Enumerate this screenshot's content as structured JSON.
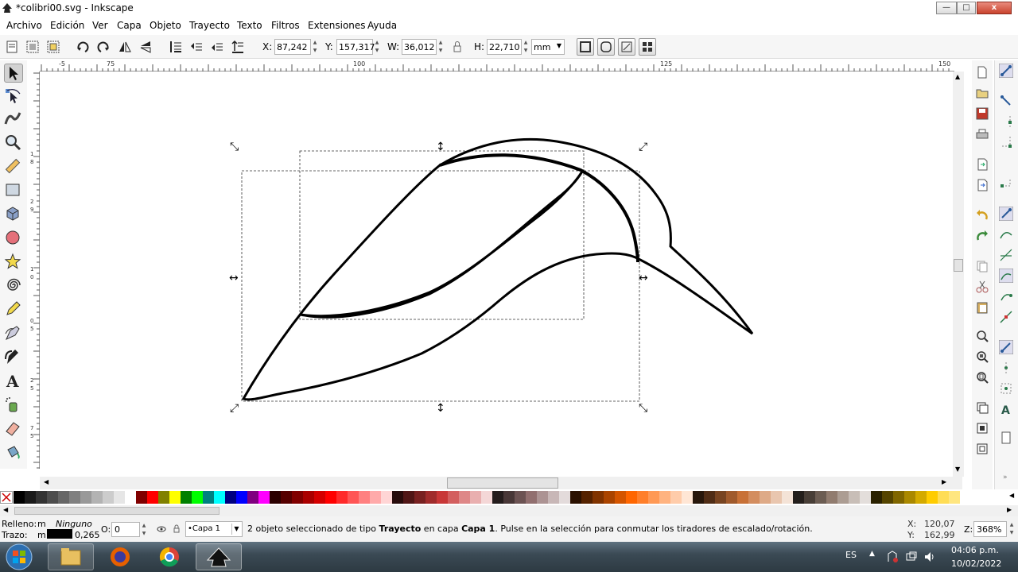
{
  "window": {
    "title": "*colibri00.svg - Inkscape",
    "min_label": "—",
    "max_label": "□",
    "close_label": "x"
  },
  "menu": [
    {
      "label": "Archivo"
    },
    {
      "label": "Edición"
    },
    {
      "label": "Ver"
    },
    {
      "label": "Capa"
    },
    {
      "label": "Objeto"
    },
    {
      "label": "Trayecto"
    },
    {
      "label": "Texto"
    },
    {
      "label": "Filtros"
    },
    {
      "label": "Extensiones"
    },
    {
      "label": "Ayuda"
    }
  ],
  "toolbar": {
    "x_label": "X:",
    "x_value": "87,242",
    "y_label": "Y:",
    "y_value": "157,317",
    "w_label": "W:",
    "w_value": "36,012",
    "h_label": "H:",
    "h_value": "22,710",
    "unit": "mm"
  },
  "rulers": {
    "top_ticks": [
      "-5",
      "75",
      "100",
      "125",
      "150"
    ],
    "left_ticks": [
      "1",
      "8",
      "2",
      "9",
      "1",
      "0",
      "0",
      "5",
      "2",
      "5",
      "7",
      "5"
    ]
  },
  "tools": [
    {
      "name": "selector-tool",
      "icon": "arrow-icon"
    },
    {
      "name": "node-tool",
      "icon": "node-icon"
    },
    {
      "name": "tweak-tool",
      "icon": "tweak-icon"
    },
    {
      "name": "zoom-tool",
      "icon": "magnifier-icon"
    },
    {
      "name": "measure-tool",
      "icon": "ruler-icon"
    },
    {
      "name": "rect-tool",
      "icon": "rectangle-icon"
    },
    {
      "name": "3dbox-tool",
      "icon": "box-icon"
    },
    {
      "name": "ellipse-tool",
      "icon": "circle-icon"
    },
    {
      "name": "star-tool",
      "icon": "star-icon"
    },
    {
      "name": "spiral-tool",
      "icon": "spiral-icon"
    },
    {
      "name": "pencil-tool",
      "icon": "pencil-icon"
    },
    {
      "name": "pen-tool",
      "icon": "pen-icon"
    },
    {
      "name": "calligraphy-tool",
      "icon": "calligraphy-icon"
    },
    {
      "name": "text-tool",
      "icon": "text-icon"
    },
    {
      "name": "spray-tool",
      "icon": "spray-icon"
    },
    {
      "name": "eraser-tool",
      "icon": "eraser-icon"
    },
    {
      "name": "bucket-tool",
      "icon": "bucket-icon"
    }
  ],
  "palette_colors": [
    "#000000",
    "#1a1a1a",
    "#333333",
    "#4d4d4d",
    "#666666",
    "#808080",
    "#999999",
    "#b3b3b3",
    "#cccccc",
    "#e6e6e6",
    "#ffffff",
    "#800000",
    "#ff0000",
    "#808000",
    "#ffff00",
    "#008000",
    "#00ff00",
    "#008080",
    "#00ffff",
    "#000080",
    "#0000ff",
    "#800080",
    "#ff00ff",
    "#2b0000",
    "#550000",
    "#800000",
    "#aa0000",
    "#d40000",
    "#ff0000",
    "#ff2a2a",
    "#ff5555",
    "#ff8080",
    "#ffaaaa",
    "#ffd5d5",
    "#280b0b",
    "#501616",
    "#782121",
    "#a02c2c",
    "#c83737",
    "#d35f5f",
    "#de8787",
    "#e9afaf",
    "#f4d7d7",
    "#241c1c",
    "#483737",
    "#6c5353",
    "#916f6f",
    "#ac9393",
    "#c8b7b7",
    "#e3dbdb",
    "#2b1100",
    "#552200",
    "#803300",
    "#aa4400",
    "#d45500",
    "#ff6600",
    "#ff7f2a",
    "#ff9955",
    "#ffb380",
    "#ffccaa",
    "#ffe6d5",
    "#28170b",
    "#502d16",
    "#784421",
    "#a05a2c",
    "#c87137",
    "#d38d5f",
    "#deaa87",
    "#e9c6af",
    "#f4e3d7",
    "#241f1c",
    "#483e37",
    "#6c5d53",
    "#917c6f",
    "#ac9d93",
    "#c8beb7",
    "#e3dedb",
    "#2b2200",
    "#554400",
    "#806600",
    "#aa8800",
    "#d4aa00",
    "#ffcc00",
    "#ffdd55",
    "#ffe680"
  ],
  "status": {
    "fill_label": "Relleno:",
    "fill_value": "m",
    "fill_none": "Ninguno",
    "stroke_label": "Trazo:",
    "stroke_value": "m",
    "stroke_width": "0,265",
    "opacity_label": "O:",
    "opacity_value": "0",
    "layer": "•Capa 1",
    "message_prefix": "2 objeto seleccionado de tipo ",
    "message_type": "Trayecto",
    "message_mid": " en capa ",
    "message_layer": "Capa 1",
    "message_suffix": ". Pulse en la selección para conmutar los tiradores de escalado/rotación.",
    "cursor_x_label": "X:",
    "cursor_x": "120,07",
    "cursor_y_label": "Y:",
    "cursor_y": "162,99",
    "zoom_label": "Z:",
    "zoom": "368%"
  },
  "taskbar": {
    "lang": "ES",
    "time": "04:06 p.m.",
    "date": "10/02/2022"
  }
}
